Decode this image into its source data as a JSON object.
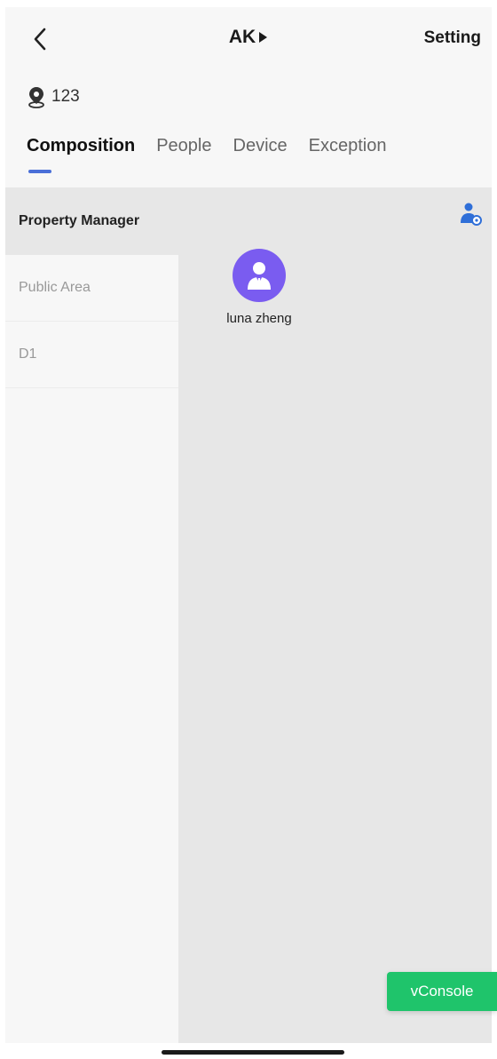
{
  "header": {
    "title": "AK",
    "setting_label": "Setting"
  },
  "location": {
    "text": "123"
  },
  "tabs": [
    {
      "label": "Composition",
      "active": true
    },
    {
      "label": "People",
      "active": false
    },
    {
      "label": "Device",
      "active": false
    },
    {
      "label": "Exception",
      "active": false
    }
  ],
  "sidebar": {
    "items": [
      {
        "label": "Property Manager",
        "active": true
      },
      {
        "label": "Public Area",
        "active": false
      },
      {
        "label": "D1",
        "active": false
      }
    ]
  },
  "members": [
    {
      "name": "luna zheng"
    }
  ],
  "vconsole_label": "vConsole",
  "colors": {
    "accent": "#4a6fd8",
    "avatar": "#7a5cf0",
    "vconsole": "#1fc46b",
    "manage_icon": "#2f6fd8"
  }
}
